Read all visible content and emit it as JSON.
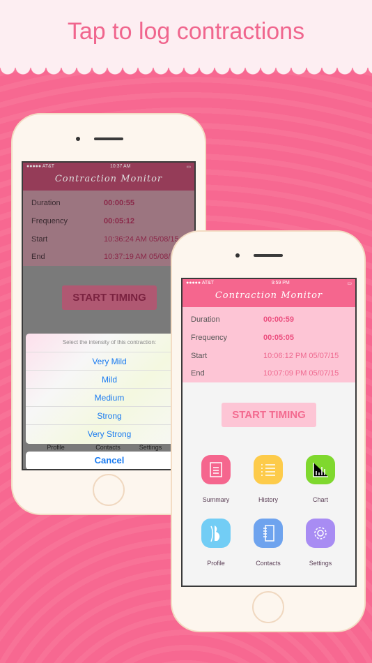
{
  "headline": "Tap to log contractions",
  "colors": {
    "brand": "#f5668e",
    "background": "#f76891",
    "header": "#fdeef2",
    "ios_blue": "#1a7bf0"
  },
  "phone_left": {
    "status": {
      "carrier": "●●●●● AT&T",
      "time": "10:37 AM"
    },
    "nav_title": "Contraction Monitor",
    "rows": [
      {
        "label": "Duration",
        "value": "00:00:55"
      },
      {
        "label": "Frequency",
        "value": "00:05:12"
      },
      {
        "label": "Start",
        "value": "10:36:24 AM 05/08/15"
      },
      {
        "label": "End",
        "value": "10:37:19 AM 05/08/15"
      }
    ],
    "start_button": "START TIMING",
    "behind_labels": [
      "Profile",
      "Contacts",
      "Settings"
    ],
    "sheet": {
      "prompt": "Select the intensity of this contraction:",
      "options": [
        "Very Mild",
        "Mild",
        "Medium",
        "Strong",
        "Very Strong"
      ],
      "cancel": "Cancel"
    }
  },
  "phone_right": {
    "status": {
      "carrier": "●●●●● AT&T",
      "time": "9:59 PM"
    },
    "nav_title": "Contraction Monitor",
    "rows": [
      {
        "label": "Duration",
        "value": "00:00:59"
      },
      {
        "label": "Frequency",
        "value": "00:05:05"
      },
      {
        "label": "Start",
        "value": "10:06:12 PM 05/07/15"
      },
      {
        "label": "End",
        "value": "10:07:09 PM 05/07/15"
      }
    ],
    "start_button": "START TIMING",
    "menu": [
      {
        "label": "Summary",
        "icon": "document-icon",
        "color": "#f5668e"
      },
      {
        "label": "History",
        "icon": "list-icon",
        "color": "#fdcb4a"
      },
      {
        "label": "Chart",
        "icon": "bar-chart-icon",
        "color": "#7fd82e"
      },
      {
        "label": "Profile",
        "icon": "pregnant-silhouette-icon",
        "color": "#72cdf5"
      },
      {
        "label": "Contacts",
        "icon": "notebook-icon",
        "color": "#6ea3ee"
      },
      {
        "label": "Settings",
        "icon": "gear-icon",
        "color": "#a88cf3"
      }
    ]
  }
}
